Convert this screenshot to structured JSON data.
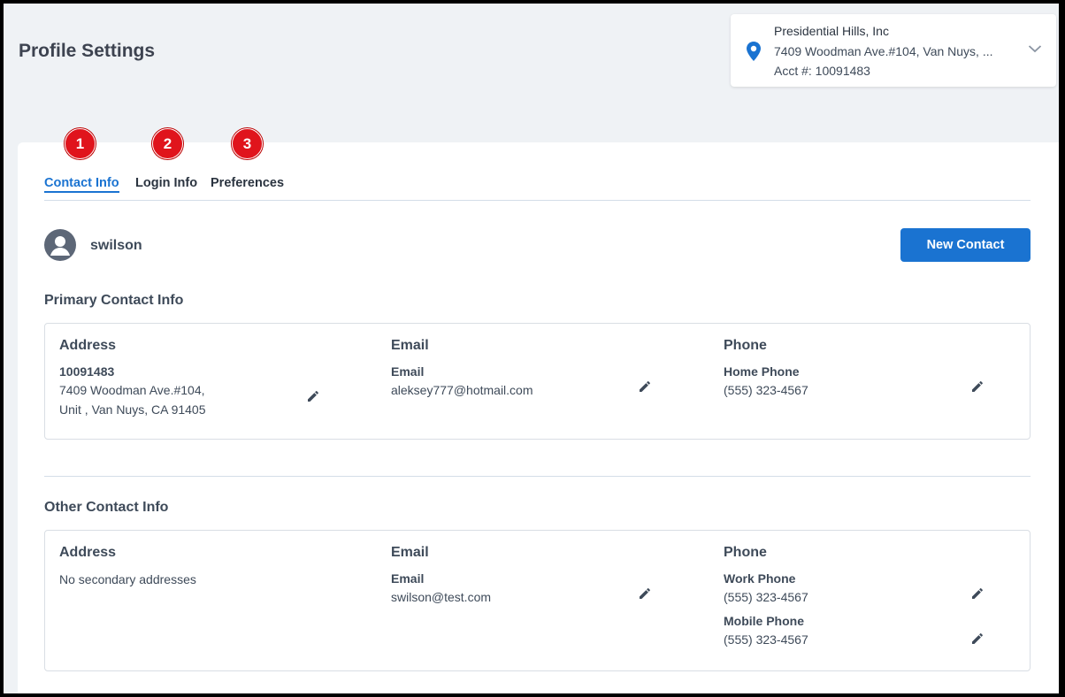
{
  "page": {
    "title": "Profile Settings"
  },
  "account": {
    "name": "Presidential Hills, Inc",
    "address": "7409 Woodman Ave.#104, Van Nuys, ...",
    "acct": "Acct #: 10091483"
  },
  "badges": [
    "1",
    "2",
    "3"
  ],
  "tabs": {
    "contact": "Contact Info",
    "login": "Login Info",
    "preferences": "Preferences"
  },
  "user": {
    "username": "swilson"
  },
  "buttons": {
    "new_contact": "New Contact"
  },
  "primary": {
    "title": "Primary Contact Info",
    "address": {
      "head": "Address",
      "number": "10091483",
      "line1": "7409 Woodman Ave.#104,",
      "line2": "Unit , Van Nuys, CA 91405"
    },
    "email": {
      "head": "Email",
      "label": "Email",
      "value": "aleksey777@hotmail.com"
    },
    "phone": {
      "head": "Phone",
      "label": "Home Phone",
      "value": "(555) 323-4567"
    }
  },
  "other": {
    "title": "Other Contact Info",
    "address": {
      "head": "Address",
      "empty": "No secondary addresses"
    },
    "email": {
      "head": "Email",
      "label": "Email",
      "value": "swilson@test.com"
    },
    "phone": {
      "head": "Phone",
      "work_label": "Work Phone",
      "work_value": "(555) 323-4567",
      "mobile_label": "Mobile Phone",
      "mobile_value": "(555) 323-4567"
    }
  },
  "colors": {
    "accent": "#1a73d1",
    "badge": "#e0141c",
    "text": "#3e4a59"
  }
}
